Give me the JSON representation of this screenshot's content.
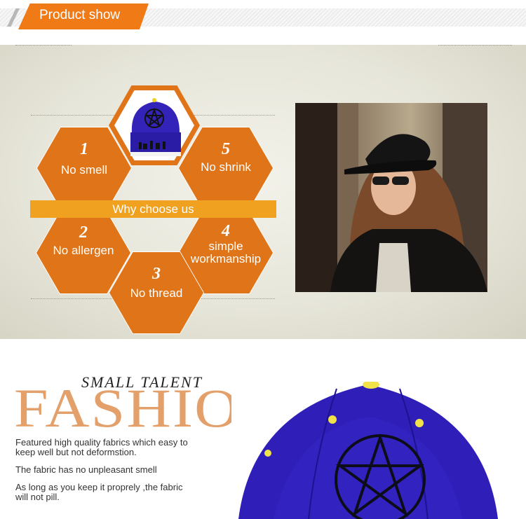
{
  "header": {
    "title": "Product show"
  },
  "features": {
    "banner_label": "Why choose us",
    "items": [
      {
        "number": "1",
        "label": "No smell"
      },
      {
        "number": "5",
        "label": "No shrink"
      },
      {
        "number": "2",
        "label": "No allergen"
      },
      {
        "number": "4",
        "label": "simple",
        "label2": "workmanship"
      },
      {
        "number": "3",
        "label": "No thread"
      }
    ]
  },
  "fashion": {
    "kicker": "SMALL TALENT",
    "headline": "FASHION",
    "descriptions": [
      {
        "line1": "Featured high quality fabrics which easy to",
        "line2": "keep well but not deformstion."
      },
      {
        "line1": "The fabric has no unpleasant smell"
      },
      {
        "line1": "As long as you keep it proprely ,the fabric",
        "line2": "will not pill."
      }
    ]
  },
  "colors": {
    "accent": "#f07a15",
    "hex": "#df7419",
    "banner": "#f0a11f",
    "headline": "#e3a06a",
    "cap_blue": "#2f1fb8"
  },
  "icons": {
    "cap": "baseball-cap-icon",
    "star": "pentagram-embroidery-icon"
  }
}
